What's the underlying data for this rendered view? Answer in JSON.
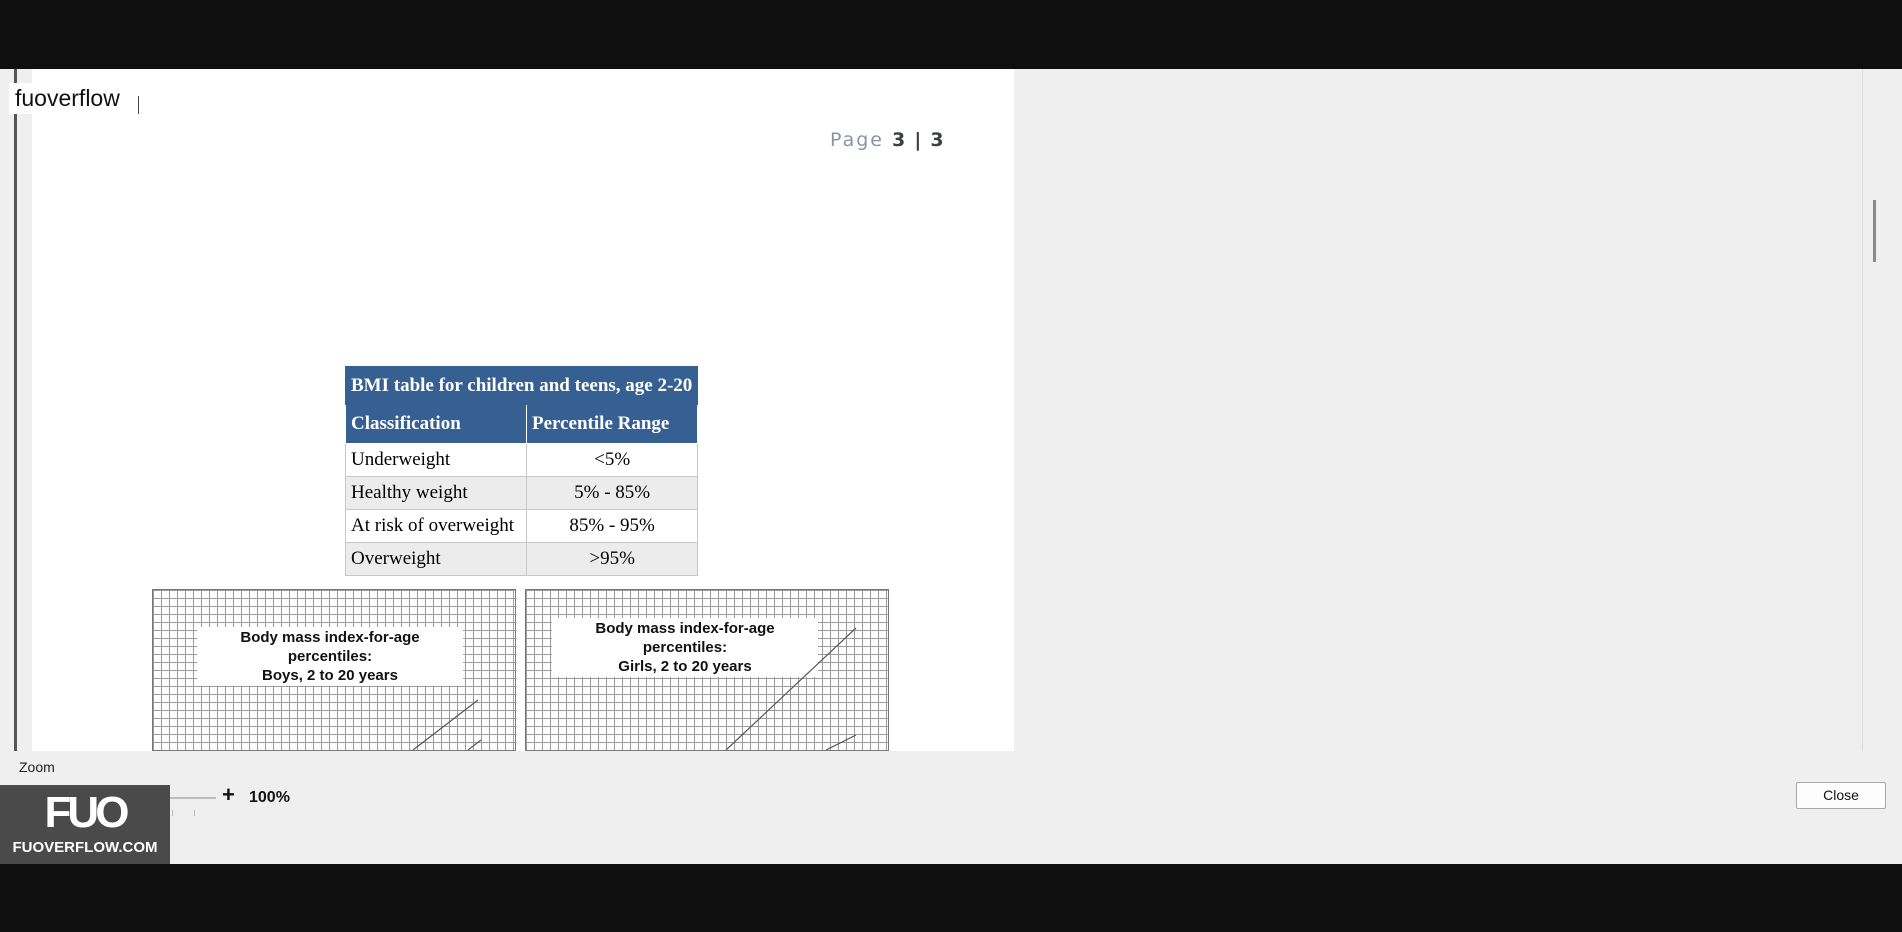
{
  "app": {
    "title": "fuoverflow"
  },
  "document": {
    "page_label": "Page",
    "page_current": "3",
    "page_sep": "|",
    "page_total": "3",
    "bmi_table": {
      "caption": "BMI table for children and teens, age 2-20",
      "headers": [
        "Classification",
        "Percentile Range"
      ],
      "rows": [
        [
          "Underweight",
          "<5%"
        ],
        [
          "Healthy weight",
          "5% - 85%"
        ],
        [
          "At risk of overweight",
          "85% - 95%"
        ],
        [
          "Overweight",
          ">95%"
        ]
      ]
    },
    "charts": [
      {
        "title": "Body mass index-for-age percentiles:",
        "subtitle": "Boys, 2 to 20 years"
      },
      {
        "title": "Body mass index-for-age percentiles:",
        "subtitle": "Girls, 2 to 20 years"
      }
    ]
  },
  "zoom": {
    "label": "Zoom",
    "minus": "-",
    "plus": "+",
    "value": "100%",
    "slider_fraction": 0.45
  },
  "buttons": {
    "close": "Close"
  },
  "watermark": {
    "logo": "FUO",
    "text": "FUOVERFLOW.COM"
  }
}
